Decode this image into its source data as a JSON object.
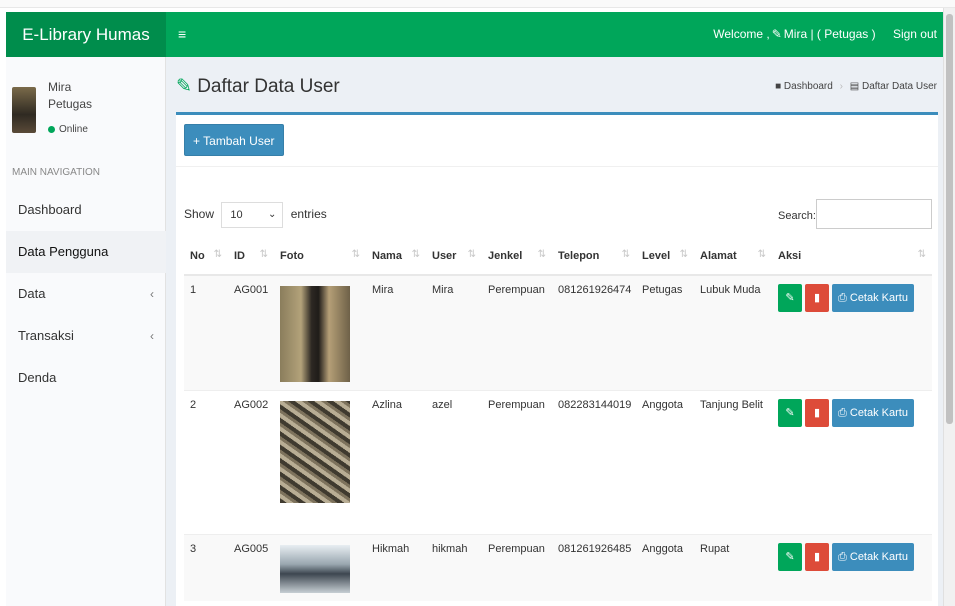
{
  "navbar": {
    "brand": "E-Library Humas",
    "toggle_icon": "≡",
    "welcome": "Welcome ,",
    "user": "Mira | ( Petugas )",
    "signout": "Sign out",
    "color": "#00a65a"
  },
  "sidebar": {
    "user_name": "Mira",
    "user_role": "Petugas",
    "status": "Online",
    "header": "MAIN NAVIGATION",
    "items": [
      {
        "label": "Dashboard",
        "chevron": ""
      },
      {
        "label": "Data Pengguna",
        "chevron": ""
      },
      {
        "label": "Data",
        "chevron": "‹"
      },
      {
        "label": "Transaksi",
        "chevron": "‹"
      },
      {
        "label": "Denda",
        "chevron": ""
      }
    ]
  },
  "page": {
    "title": "Daftar Data User",
    "breadcrumb": [
      "Dashboard",
      "Daftar Data User"
    ]
  },
  "box": {
    "add_button": "Tambah User",
    "show_label": "Show",
    "entries_value": "10",
    "entries_label": "entries",
    "search_label": "Search:",
    "search_value": ""
  },
  "table": {
    "headers": [
      "No",
      "ID",
      "Foto",
      "Nama",
      "User",
      "Jenkel",
      "Telepon",
      "Level",
      "Alamat",
      "Aksi"
    ],
    "rows": [
      {
        "no": "1",
        "id": "AG001",
        "nama": "Mira",
        "user": "Mira",
        "jenkel": "Perempuan",
        "telepon": "081261926474",
        "level": "Petugas",
        "alamat": "Lubuk Muda"
      },
      {
        "no": "2",
        "id": "AG002",
        "nama": "Azlina",
        "user": "azel",
        "jenkel": "Perempuan",
        "telepon": "082283144019",
        "level": "Anggota",
        "alamat": "Tanjung Belit"
      },
      {
        "no": "3",
        "id": "AG005",
        "nama": "Hikmah",
        "user": "hikmah",
        "jenkel": "Perempuan",
        "telepon": "081261926485",
        "level": "Anggota",
        "alamat": "Rupat"
      }
    ],
    "print_label": "Cetak Kartu"
  }
}
